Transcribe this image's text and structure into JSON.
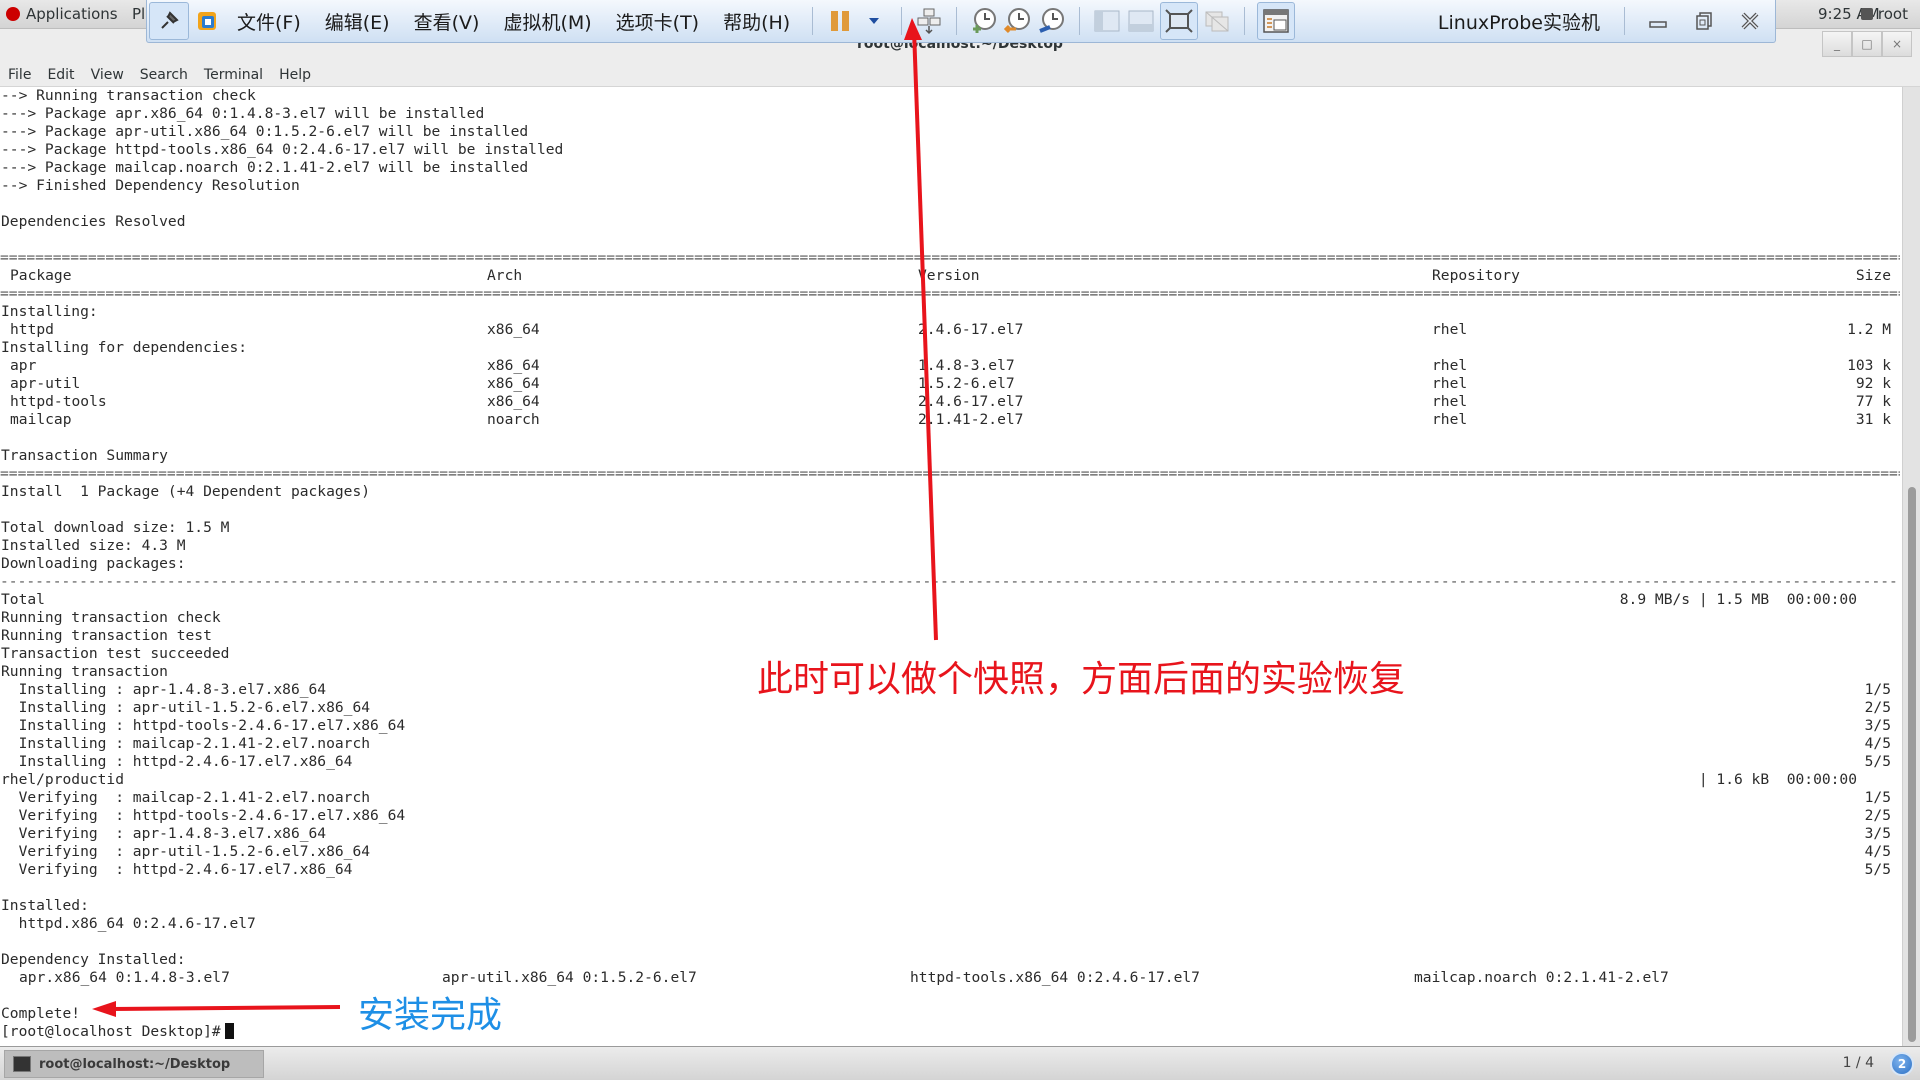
{
  "gnome_bar": {
    "applications": "Applications",
    "places_partial": "Pl",
    "clock": "9:25 AM",
    "user": "root"
  },
  "vm_toolbar": {
    "menus": [
      "文件(F)",
      "编辑(E)",
      "查看(V)",
      "虚拟机(M)",
      "选项卡(T)",
      "帮助(H)"
    ],
    "title": "LinuxProbe实验机",
    "icons": [
      "pin-icon",
      "vmware-logo-icon",
      "pause-icon",
      "dropdown-arrow-icon",
      "send-ctrl-alt-del-icon",
      "take-snapshot-icon",
      "revert-snapshot-icon",
      "snapshot-manager-icon",
      "show-library-icon",
      "thumbnail-bar-icon",
      "full-screen-icon",
      "unity-icon",
      "console-view-icon"
    ],
    "window_controls": [
      "minimize",
      "restore",
      "close"
    ]
  },
  "terminal": {
    "title": "root@localhost:~/Desktop",
    "menu": [
      "File",
      "Edit",
      "View",
      "Search",
      "Terminal",
      "Help"
    ],
    "pre_lines": [
      "--> Running transaction check",
      "---> Package apr.x86_64 0:1.4.8-3.el7 will be installed",
      "---> Package apr-util.x86_64 0:1.5.2-6.el7 will be installed",
      "---> Package httpd-tools.x86_64 0:2.4.6-17.el7 will be installed",
      "---> Package mailcap.noarch 0:2.1.41-2.el7 will be installed",
      "--> Finished Dependency Resolution",
      "",
      "Dependencies Resolved"
    ],
    "table": {
      "headers": {
        "package": "Package",
        "arch": "Arch",
        "version": "Version",
        "repository": "Repository",
        "size": "Size"
      },
      "installing_label": "Installing:",
      "installing": [
        {
          "package": "httpd",
          "arch": "x86_64",
          "version": "2.4.6-17.el7",
          "repository": "rhel",
          "size": "1.2 M"
        }
      ],
      "deps_label": "Installing for dependencies:",
      "deps": [
        {
          "package": "apr",
          "arch": "x86_64",
          "version": "1.4.8-3.el7",
          "repository": "rhel",
          "size": "103 k"
        },
        {
          "package": "apr-util",
          "arch": "x86_64",
          "version": "1.5.2-6.el7",
          "repository": "rhel",
          "size": "92 k"
        },
        {
          "package": "httpd-tools",
          "arch": "x86_64",
          "version": "2.4.6-17.el7",
          "repository": "rhel",
          "size": "77 k"
        },
        {
          "package": "mailcap",
          "arch": "noarch",
          "version": "2.1.41-2.el7",
          "repository": "rhel",
          "size": "31 k"
        }
      ]
    },
    "summary": {
      "title": "Transaction Summary",
      "install_line": "Install  1 Package (+4 Dependent packages)",
      "download_size": "Total download size: 1.5 M",
      "installed_size": "Installed size: 4.3 M",
      "downloading": "Downloading packages:"
    },
    "total": {
      "label": "Total",
      "stats": "8.9 MB/s | 1.5 MB  00:00:00"
    },
    "run_lines": [
      "Running transaction check",
      "Running transaction test",
      "Transaction test succeeded",
      "Running transaction"
    ],
    "steps": [
      {
        "text": "  Installing : apr-1.4.8-3.el7.x86_64",
        "count": "1/5"
      },
      {
        "text": "  Installing : apr-util-1.5.2-6.el7.x86_64",
        "count": "2/5"
      },
      {
        "text": "  Installing : httpd-tools-2.4.6-17.el7.x86_64",
        "count": "3/5"
      },
      {
        "text": "  Installing : mailcap-2.1.41-2.el7.noarch",
        "count": "4/5"
      },
      {
        "text": "  Installing : httpd-2.4.6-17.el7.x86_64",
        "count": "5/5"
      }
    ],
    "productid": {
      "text": "rhel/productid",
      "stats": "| 1.6 kB  00:00:00"
    },
    "verify_steps": [
      {
        "text": "  Verifying  : mailcap-2.1.41-2.el7.noarch",
        "count": "1/5"
      },
      {
        "text": "  Verifying  : httpd-tools-2.4.6-17.el7.x86_64",
        "count": "2/5"
      },
      {
        "text": "  Verifying  : apr-1.4.8-3.el7.x86_64",
        "count": "3/5"
      },
      {
        "text": "  Verifying  : apr-util-1.5.2-6.el7.x86_64",
        "count": "4/5"
      },
      {
        "text": "  Verifying  : httpd-2.4.6-17.el7.x86_64",
        "count": "5/5"
      }
    ],
    "installed": {
      "label": "Installed:",
      "item": "  httpd.x86_64 0:2.4.6-17.el7"
    },
    "dep_installed": {
      "label": "Dependency Installed:",
      "items": [
        "apr.x86_64 0:1.4.8-3.el7",
        "apr-util.x86_64 0:1.5.2-6.el7",
        "httpd-tools.x86_64 0:2.4.6-17.el7",
        "mailcap.noarch 0:2.1.41-2.el7"
      ]
    },
    "complete": "Complete!",
    "prompt": "[root@localhost Desktop]#"
  },
  "annotations": {
    "snapshot_note": "此时可以做个快照，方面后面的实验恢复",
    "complete_note": "安装完成",
    "colors": {
      "red": "#e8141c",
      "blue": "#1e8fe6"
    }
  },
  "taskbar": {
    "task": "root@localhost:~/Desktop",
    "workspace": "1 / 4",
    "badge": "2"
  }
}
